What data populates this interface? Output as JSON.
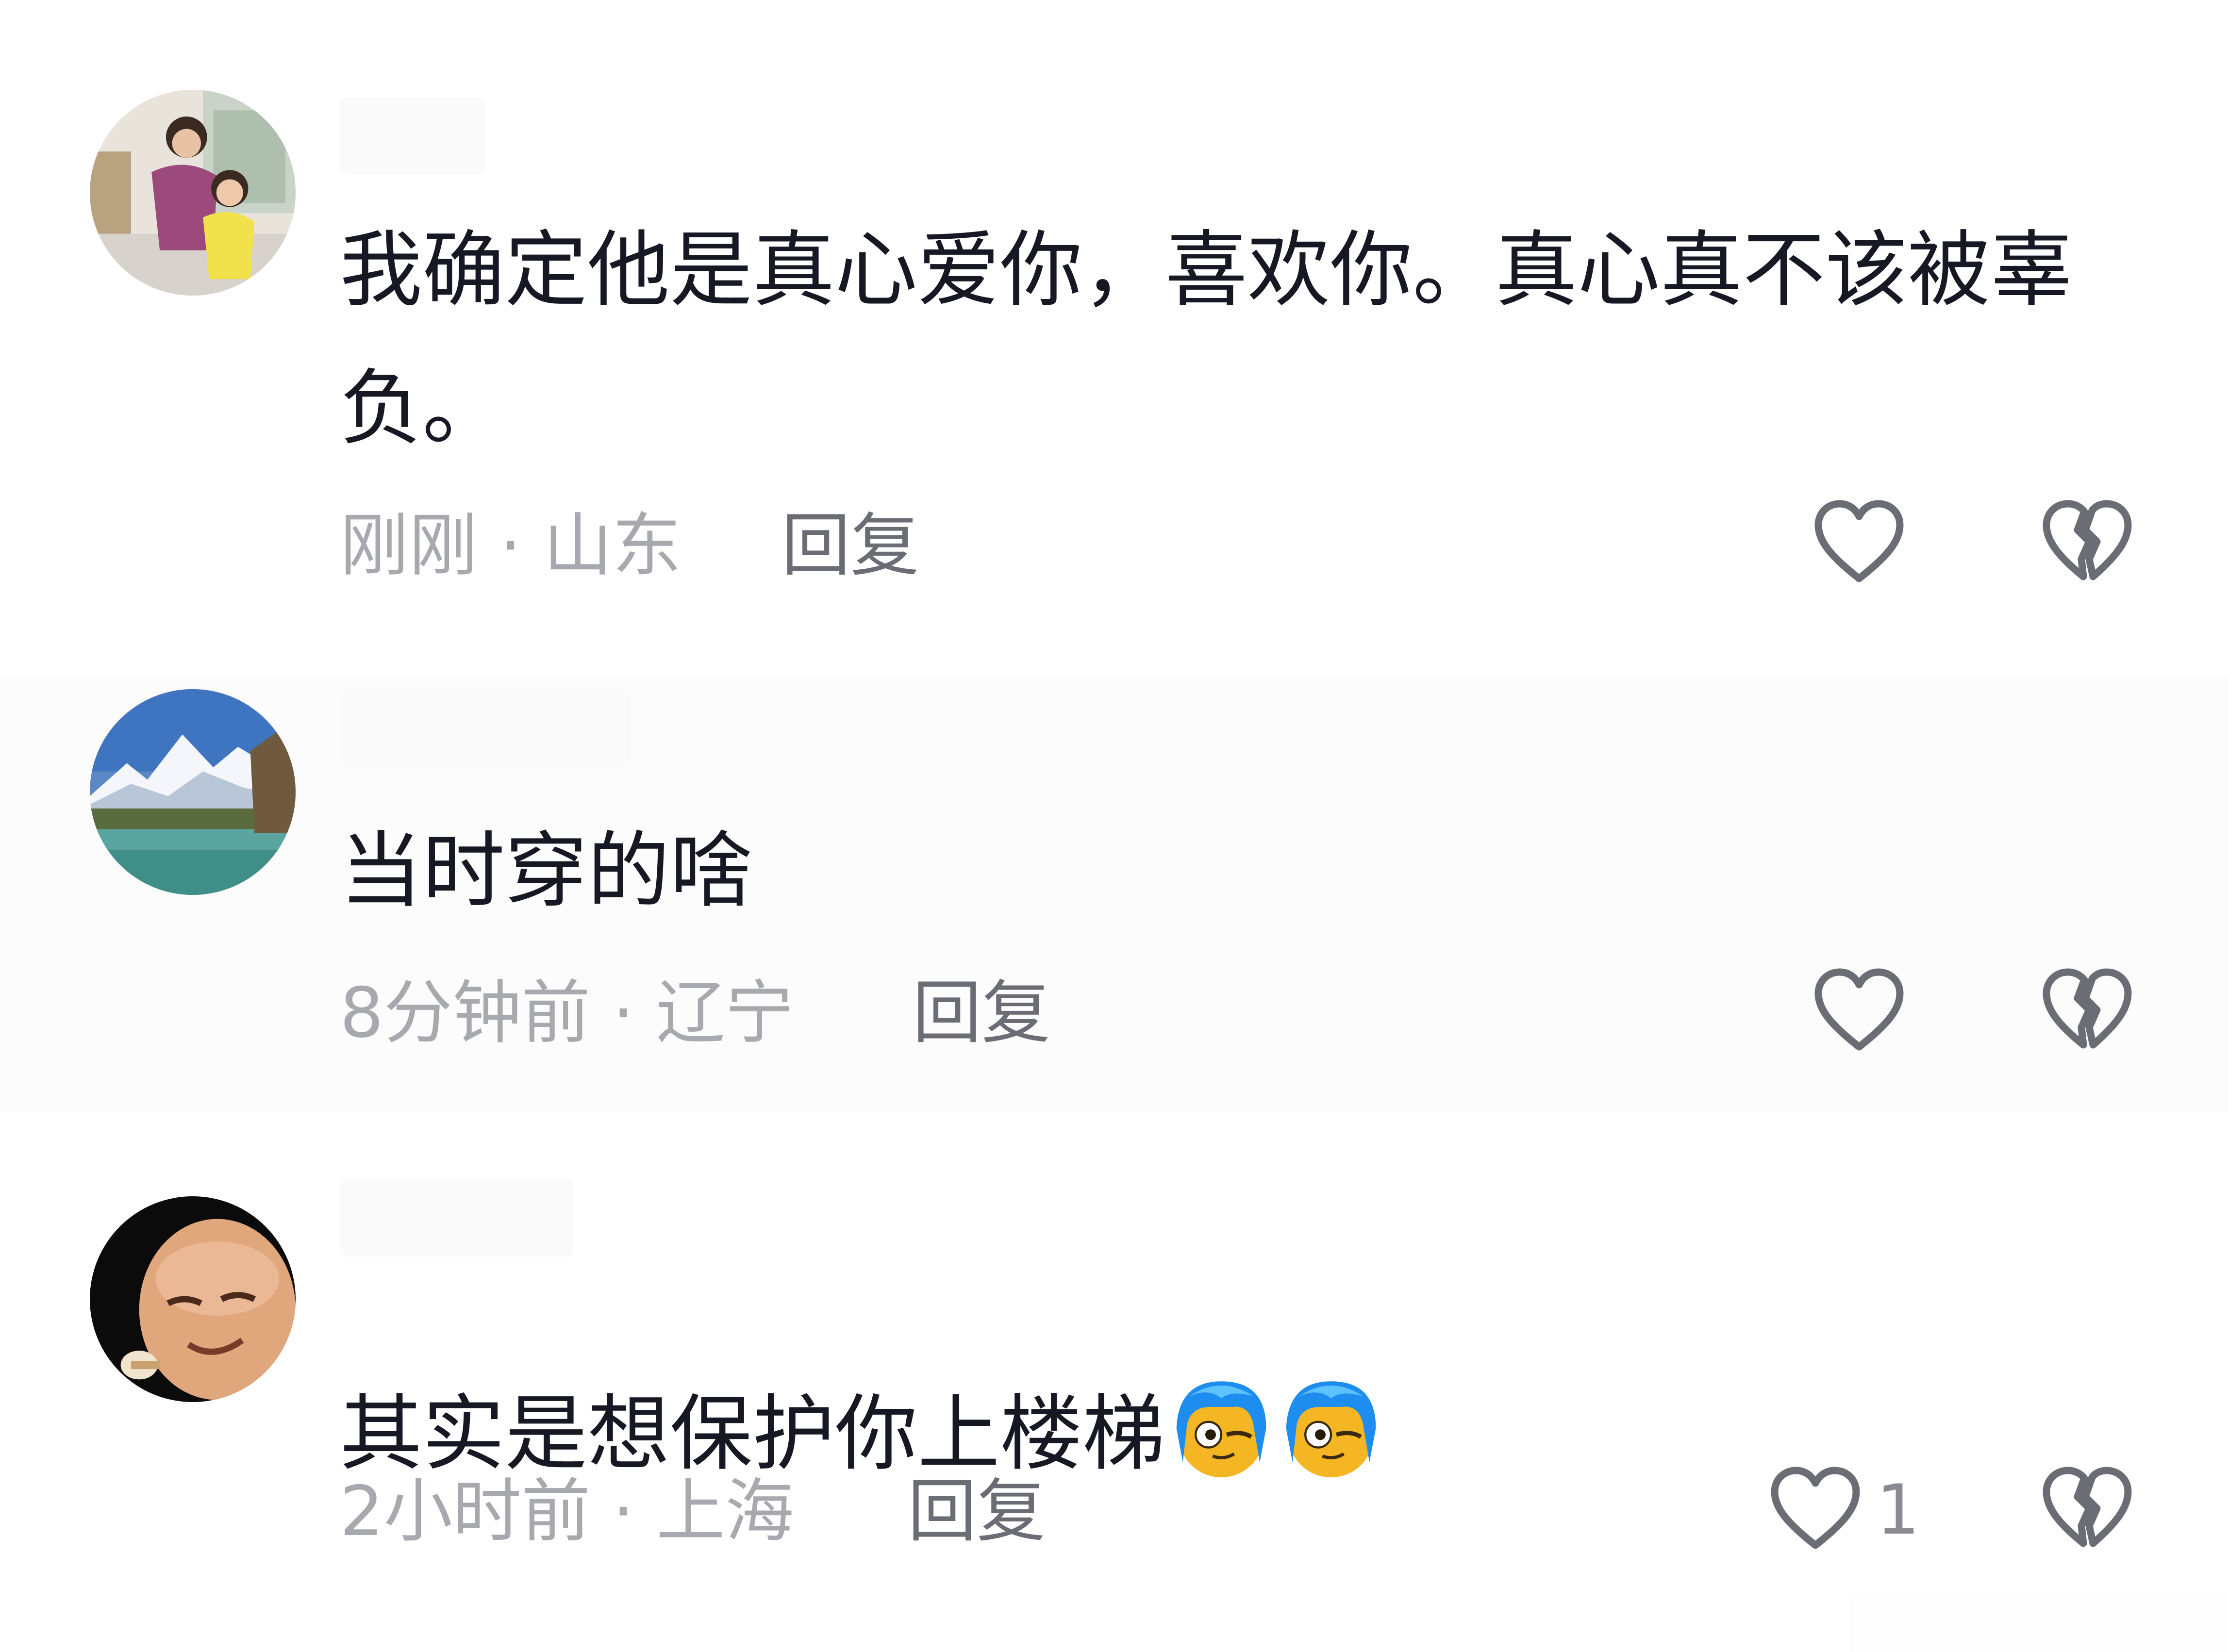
{
  "comments": [
    {
      "text_line1": "我确定他是真心爱你，喜欢你。真心真不该被辜",
      "text_line2": "负。",
      "time_location": "刚刚 · 山东",
      "reply_label": "回复",
      "like_count": ""
    },
    {
      "text_line1": "当时穿的啥",
      "time_location": "8分钟前 · 辽宁",
      "reply_label": "回复",
      "like_count": ""
    },
    {
      "text_line1": "其实是想保护你上楼梯",
      "time_location": "2小时前 · 上海",
      "reply_label": "回复",
      "like_count": "1"
    }
  ],
  "icons": {
    "like": "heart-outline-icon",
    "dislike": "broken-heart-icon",
    "emoji": "blue-hair-face-emoji"
  },
  "colors": {
    "text": "#161823",
    "meta": "#a8a9ae",
    "reply": "#6b6d74",
    "icon": "#6b6d74"
  }
}
